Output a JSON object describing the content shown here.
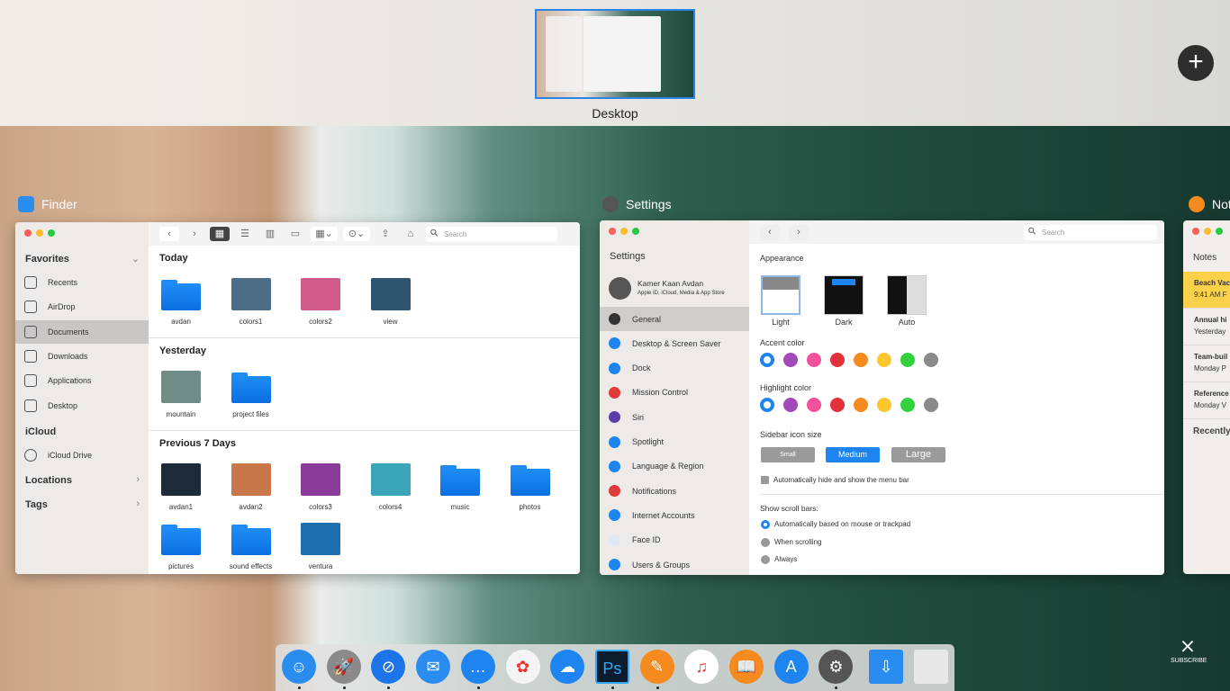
{
  "spaces": {
    "desktop_label": "Desktop",
    "add_label": "+"
  },
  "finder": {
    "title": "Finder",
    "sidebar": {
      "favorites": "Favorites",
      "items": [
        {
          "label": "Recents"
        },
        {
          "label": "AirDrop"
        },
        {
          "label": "Documents",
          "selected": true
        },
        {
          "label": "Downloads"
        },
        {
          "label": "Applications"
        },
        {
          "label": "Desktop"
        }
      ],
      "icloud": "iCloud",
      "icloud_drive": "iCloud Drive",
      "locations": "Locations",
      "tags": "Tags"
    },
    "toolbar": {
      "back": "‹",
      "forward": "›",
      "search_placeholder": "Search"
    },
    "groups": [
      {
        "title": "Today",
        "files": [
          {
            "name": "avdan",
            "kind": "folder"
          },
          {
            "name": "colors1",
            "kind": "image",
            "color": "#4d6d86"
          },
          {
            "name": "colors2",
            "kind": "image",
            "color": "#d05a8a"
          },
          {
            "name": "view",
            "kind": "image",
            "color": "#2f5470"
          }
        ]
      },
      {
        "title": "Yesterday",
        "files": [
          {
            "name": "mountain",
            "kind": "image",
            "color": "#6f8c86"
          },
          {
            "name": "project files",
            "kind": "folder"
          }
        ]
      },
      {
        "title": "Previous 7 Days",
        "files": [
          {
            "name": "avdan1",
            "kind": "image",
            "color": "#1c2a3a"
          },
          {
            "name": "avdan2",
            "kind": "image",
            "color": "#c7774a"
          },
          {
            "name": "colors3",
            "kind": "image",
            "color": "#8a3c9a"
          },
          {
            "name": "colors4",
            "kind": "image",
            "color": "#3aa6b8"
          },
          {
            "name": "music",
            "kind": "folder"
          },
          {
            "name": "photos",
            "kind": "folder"
          },
          {
            "name": "pictures",
            "kind": "folder"
          },
          {
            "name": "sound effects",
            "kind": "folder"
          },
          {
            "name": "ventura",
            "kind": "image",
            "color": "#1f6fb0"
          }
        ]
      }
    ]
  },
  "settings": {
    "title": "Settings",
    "sidebar_title": "Settings",
    "user": {
      "name": "Kamer Kaan Avdan",
      "subtitle": "Apple ID, iCloud, Media & App Store"
    },
    "search_placeholder": "Search",
    "items": [
      {
        "label": "General",
        "color": "#333333",
        "selected": true
      },
      {
        "label": "Desktop & Screen Saver",
        "color": "#1d84f0"
      },
      {
        "label": "Dock",
        "color": "#1d84f0"
      },
      {
        "label": "Mission Control",
        "color": "#e03a3a"
      },
      {
        "label": "Siri",
        "color": "#5a3fa8"
      },
      {
        "label": "Spotlight",
        "color": "#1d84f0"
      },
      {
        "label": "Language & Region",
        "color": "#1d84f0"
      },
      {
        "label": "Notifications",
        "color": "#e03a3a"
      },
      {
        "label": "Internet Accounts",
        "color": "#1d84f0"
      },
      {
        "label": "Face ID",
        "color": "#dfe9f5"
      },
      {
        "label": "Users & Groups",
        "color": "#1d84f0"
      }
    ],
    "appearance": {
      "label": "Appearance",
      "options": [
        "Light",
        "Dark",
        "Auto"
      ]
    },
    "accent": {
      "label": "Accent color"
    },
    "highlight": {
      "label": "Highlight color"
    },
    "colors": [
      "#1d84f0",
      "#a24bb6",
      "#f2529c",
      "#e3303a",
      "#f58a1f",
      "#fcc62f",
      "#32d23d",
      "#8a8a8a"
    ],
    "icon_size": {
      "label": "Sidebar icon size",
      "options": [
        "Small",
        "Medium",
        "Large"
      ],
      "selected": "Medium"
    },
    "menu_bar": "Automatically hide and show the menu bar",
    "scroll": {
      "label": "Show scroll bars:",
      "options": [
        "Automatically based on mouse or trackpad",
        "When scrolling",
        "Always"
      ]
    }
  },
  "notes": {
    "title": "Notes",
    "header": "Notes",
    "items": [
      {
        "title": "Beach Vac",
        "sub": "9:41 AM  F"
      },
      {
        "title": "Annual hi",
        "sub": "Yesterday"
      },
      {
        "title": "Team-buil",
        "sub": "Monday  P"
      },
      {
        "title": "Reference",
        "sub": "Monday  V"
      }
    ],
    "recently": "Recently"
  },
  "dock": [
    {
      "name": "finder",
      "color": "#2b8cf0",
      "glyph": "☺",
      "running": true
    },
    {
      "name": "launchpad",
      "color": "#8a8a8a",
      "glyph": "🚀",
      "running": true
    },
    {
      "name": "safari",
      "color": "#1d74e8",
      "glyph": "⊘",
      "running": true
    },
    {
      "name": "mail",
      "color": "#2b8cf0",
      "glyph": "✉"
    },
    {
      "name": "messages",
      "color": "#1d84f0",
      "glyph": "…",
      "running": true
    },
    {
      "name": "photos",
      "color": "#f4f4f4",
      "glyph": "✿"
    },
    {
      "name": "weather",
      "color": "#1d84f0",
      "glyph": "☁"
    },
    {
      "name": "photoshop",
      "color": "#0b1d2c",
      "glyph": "Ps",
      "running": true
    },
    {
      "name": "notes",
      "color": "#f58a1f",
      "glyph": "✎",
      "running": true
    },
    {
      "name": "music",
      "color": "#ffffff",
      "glyph": "♫"
    },
    {
      "name": "books",
      "color": "#f58a1f",
      "glyph": "📖"
    },
    {
      "name": "app-store",
      "color": "#1d84f0",
      "glyph": "A"
    },
    {
      "name": "system-preferences",
      "color": "#555555",
      "glyph": "⚙",
      "running": true
    },
    {
      "name": "downloads",
      "color": "#2b8cf0",
      "glyph": "⇩"
    },
    {
      "name": "trash",
      "color": "#e8e8e8",
      "glyph": ""
    }
  ],
  "watermark": "SUBSCRIBE"
}
